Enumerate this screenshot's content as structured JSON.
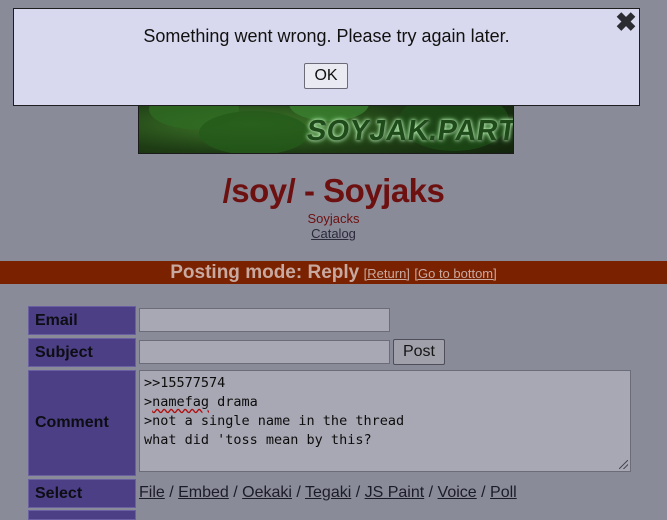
{
  "banner": {
    "text": "SOYJAK.PARTY"
  },
  "board": {
    "title": "/soy/ - Soyjaks",
    "subtitle": "Soyjacks",
    "catalog_link": "Catalog"
  },
  "mode_bar": {
    "title": "Posting mode: Reply",
    "return_link": "[Return]",
    "bottom_link": "[Go to bottom]"
  },
  "form": {
    "email_label": "Email",
    "email_value": "",
    "subject_label": "Subject",
    "subject_value": "",
    "post_button": "Post",
    "comment_label": "Comment",
    "comment_lines": [
      "&gt;&gt;15577574",
      "&gt;namefag drama",
      "&gt;not a single name in the thread",
      "what did 'toss mean by this?"
    ],
    "select_label": "Select",
    "select_links": [
      "File",
      "Embed",
      "Oekaki",
      "Tegaki",
      "JS Paint",
      "Voice",
      "Poll"
    ]
  },
  "dialog": {
    "message": "Something went wrong. Please try again later.",
    "ok_label": "OK",
    "close_symbol": "✖"
  },
  "colors": {
    "page_bg": "#8a8b99",
    "mode_bar": "#7a2100",
    "form_label": "#4c3f86",
    "title": "#6d1010",
    "dialog_bg": "#d8d9ee"
  }
}
